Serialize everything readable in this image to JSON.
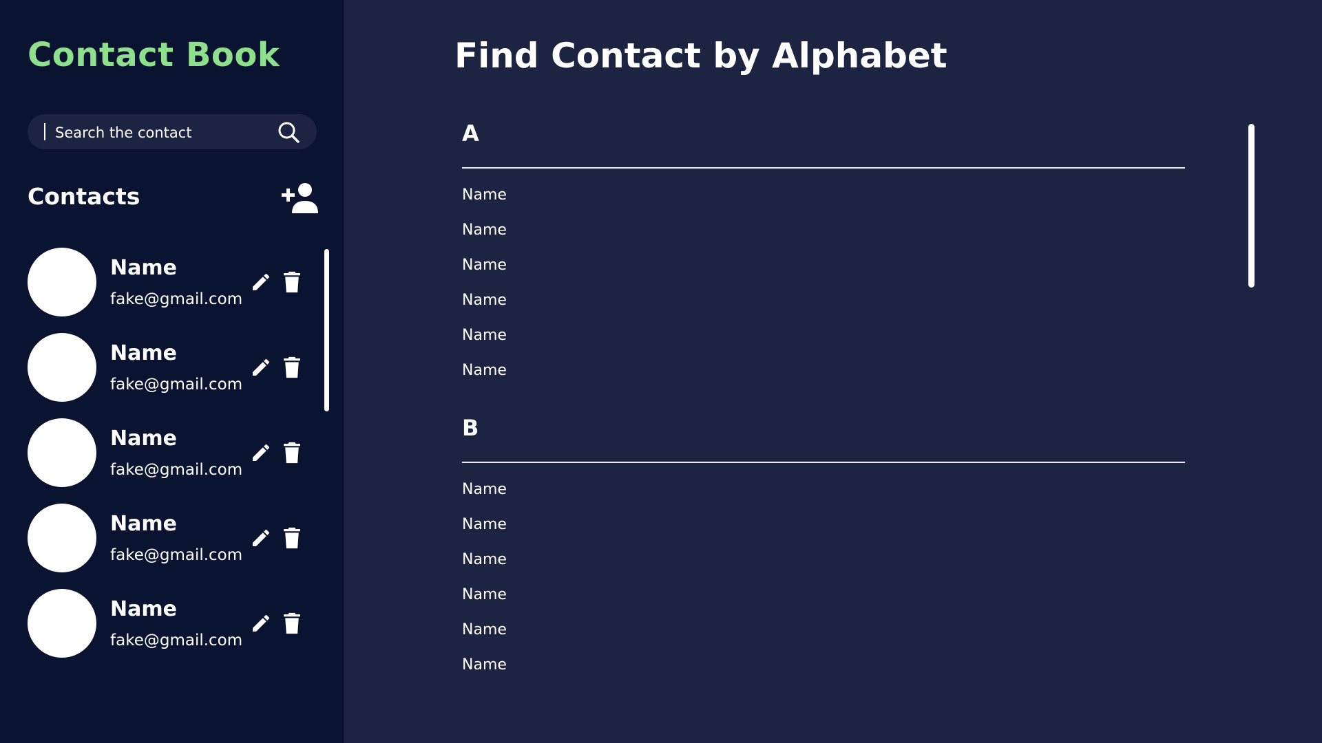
{
  "app": {
    "title": "Contact Book"
  },
  "search": {
    "placeholder": "Search the contact"
  },
  "contacts": {
    "heading": "Contacts",
    "items": [
      {
        "name": "Name",
        "email": "fake@gmail.com"
      },
      {
        "name": "Name",
        "email": "fake@gmail.com"
      },
      {
        "name": "Name",
        "email": "fake@gmail.com"
      },
      {
        "name": "Name",
        "email": "fake@gmail.com"
      },
      {
        "name": "Name",
        "email": "fake@gmail.com"
      }
    ]
  },
  "main": {
    "title": "Find Contact by Alphabet",
    "sections": [
      {
        "letter": "A",
        "names": [
          "Name",
          "Name",
          "Name",
          "Name",
          "Name",
          "Name"
        ]
      },
      {
        "letter": "B",
        "names": [
          "Name",
          "Name",
          "Name",
          "Name",
          "Name",
          "Name"
        ]
      }
    ]
  },
  "icons": {
    "search": "search-icon",
    "add_contact": "add-contact-icon",
    "edit": "pencil-icon",
    "delete": "trash-icon"
  },
  "colors": {
    "sidebar_bg": "#0a1430",
    "main_bg": "#1d2442",
    "accent": "#8ee08c",
    "text": "#ffffff"
  }
}
